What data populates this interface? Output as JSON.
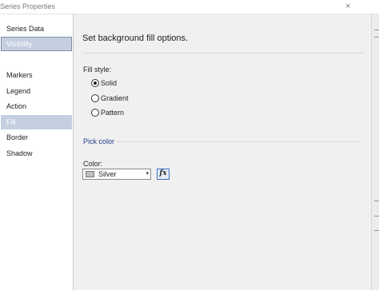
{
  "window": {
    "title": "Series Properties",
    "close_glyph": "×"
  },
  "sidebar": {
    "items": [
      {
        "label": "Series Data"
      },
      {
        "label": "Visibility"
      },
      {
        "label": "Markers"
      },
      {
        "label": "Legend"
      },
      {
        "label": "Action"
      },
      {
        "label": "Fill"
      },
      {
        "label": "Border"
      },
      {
        "label": "Shadow"
      }
    ]
  },
  "main": {
    "heading": "Set background fill options.",
    "fill_style": {
      "label": "Fill style:",
      "options": [
        {
          "label": "Solid",
          "selected": true
        },
        {
          "label": "Gradient",
          "selected": false
        },
        {
          "label": "Pattern",
          "selected": false
        }
      ]
    },
    "pick_color": {
      "section_title": "Pick color",
      "color_label": "Color:",
      "selected_color": "Silver",
      "swatch_hex": "#c0c0c0",
      "dropdown_caret": "▾",
      "expression_button": "fx"
    }
  },
  "colors": {
    "selected_nav_bg": "#c4cfe0",
    "section_title": "#1f3d8c",
    "expression_border": "#3c6fbf"
  }
}
